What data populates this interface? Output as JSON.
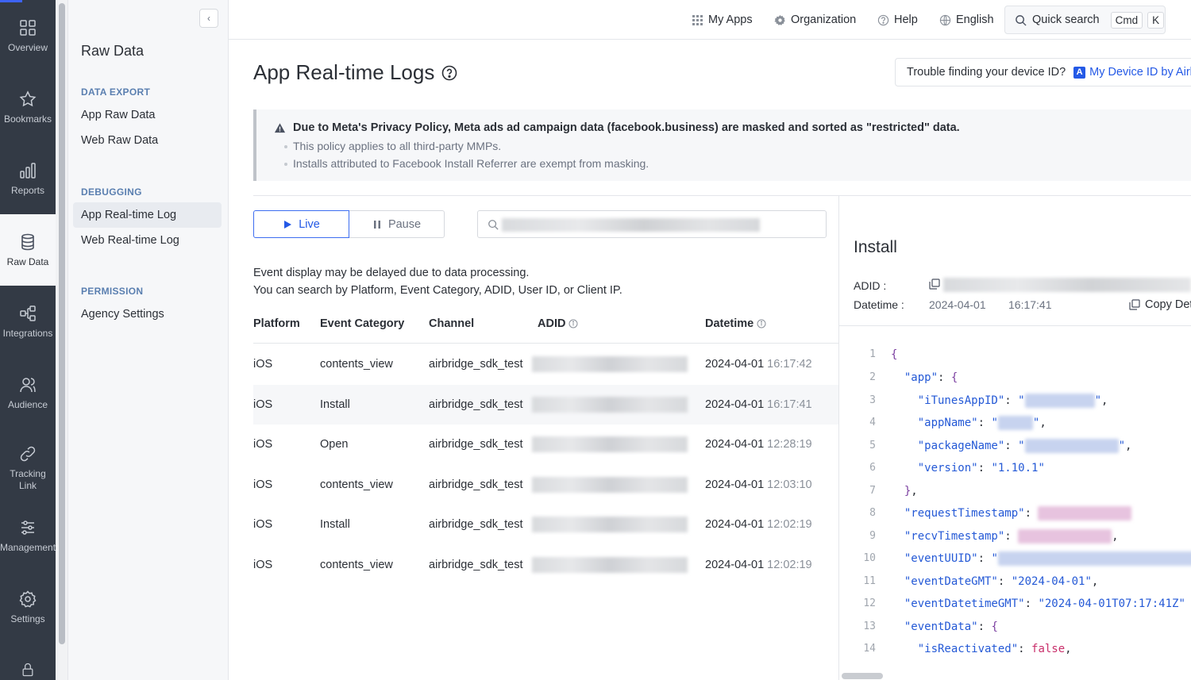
{
  "rail": {
    "items": [
      {
        "label": "Overview",
        "icon": "overview-icon"
      },
      {
        "label": "Bookmarks",
        "icon": "star-icon"
      },
      {
        "label": "Reports",
        "icon": "bar-chart-icon"
      },
      {
        "label": "Raw Data",
        "icon": "database-icon",
        "active": true
      },
      {
        "label": "Integrations",
        "icon": "integrations-icon"
      },
      {
        "label": "Audience",
        "icon": "users-icon"
      },
      {
        "label": "Tracking Link",
        "icon": "link-icon"
      },
      {
        "label": "Management",
        "icon": "sliders-icon"
      },
      {
        "label": "Settings",
        "icon": "gear-icon"
      }
    ]
  },
  "subnav": {
    "title": "Raw Data",
    "sections": [
      {
        "heading": "DATA EXPORT",
        "links": [
          "App Raw Data",
          "Web Raw Data"
        ]
      },
      {
        "heading": "DEBUGGING",
        "links": [
          "App Real-time Log",
          "Web Real-time Log"
        ]
      },
      {
        "heading": "PERMISSION",
        "links": [
          "Agency Settings"
        ]
      }
    ],
    "active_link": "App Real-time Log"
  },
  "topbar": {
    "my_apps": "My Apps",
    "organization": "Organization",
    "help": "Help",
    "language": "English",
    "quick_search": "Quick search",
    "kbd_cmd": "Cmd",
    "kbd_k": "K"
  },
  "page": {
    "title": "App Real-time Logs",
    "device_question": "Trouble finding your device ID?",
    "device_link": "My Device ID by Airbridge",
    "device_link_badge": "A"
  },
  "alert": {
    "title": "Due to Meta's Privacy Policy, Meta ads ad campaign data (facebook.business) are masked and sorted as \"restricted\" data.",
    "bullets": [
      "This policy applies to all third-party MMPs.",
      "Installs attributed to Facebook Install Referrer are exempt from masking."
    ]
  },
  "controls": {
    "live_label": "Live",
    "pause_label": "Pause"
  },
  "info": {
    "line1": "Event display may be delayed due to data processing.",
    "line2": "You can search by Platform, Event Category, ADID, User ID, or Client IP."
  },
  "table": {
    "columns": [
      "Platform",
      "Event Category",
      "Channel",
      "ADID",
      "Datetime"
    ],
    "rows": [
      {
        "platform": "iOS",
        "category": "contents_view",
        "channel": "airbridge_sdk_test",
        "date": "2024-04-01",
        "time": "16:17:42"
      },
      {
        "platform": "iOS",
        "category": "Install",
        "channel": "airbridge_sdk_test",
        "date": "2024-04-01",
        "time": "16:17:41"
      },
      {
        "platform": "iOS",
        "category": "Open",
        "channel": "airbridge_sdk_test",
        "date": "2024-04-01",
        "time": "12:28:19"
      },
      {
        "platform": "iOS",
        "category": "contents_view",
        "channel": "airbridge_sdk_test",
        "date": "2024-04-01",
        "time": "12:03:10"
      },
      {
        "platform": "iOS",
        "category": "Install",
        "channel": "airbridge_sdk_test",
        "date": "2024-04-01",
        "time": "12:02:19"
      },
      {
        "platform": "iOS",
        "category": "contents_view",
        "channel": "airbridge_sdk_test",
        "date": "2024-04-01",
        "time": "12:02:19"
      }
    ],
    "selected_row": 1
  },
  "detail": {
    "title": "Install",
    "adid_label": "ADID :",
    "datetime_label": "Datetime :",
    "date": "2024-04-01",
    "time": "16:17:41",
    "copy_label": "Copy Details"
  },
  "code": {
    "line_numbers": [
      "1",
      "2",
      "3",
      "4",
      "5",
      "6",
      "7",
      "8",
      "9",
      "10",
      "11",
      "12",
      "13",
      "14"
    ],
    "version_value": "\"1.10.1\"",
    "event_date_gmt": "\"2024-04-01\"",
    "event_datetime_gmt": "\"2024-04-01T07:17:41Z\"",
    "is_reactivated": "false",
    "keys": {
      "app": "\"app\"",
      "itunes": "\"iTunesAppID\"",
      "appname": "\"appName\"",
      "package": "\"packageName\"",
      "version": "\"version\"",
      "requestTs": "\"requestTimestamp\"",
      "recvTs": "\"recvTimestamp\"",
      "uuid": "\"eventUUID\"",
      "dateGmt": "\"eventDateGMT\"",
      "datetimeGmt": "\"eventDatetimeGMT\"",
      "eventData": "\"eventData\"",
      "isReactivated": "\"isReactivated\""
    }
  }
}
